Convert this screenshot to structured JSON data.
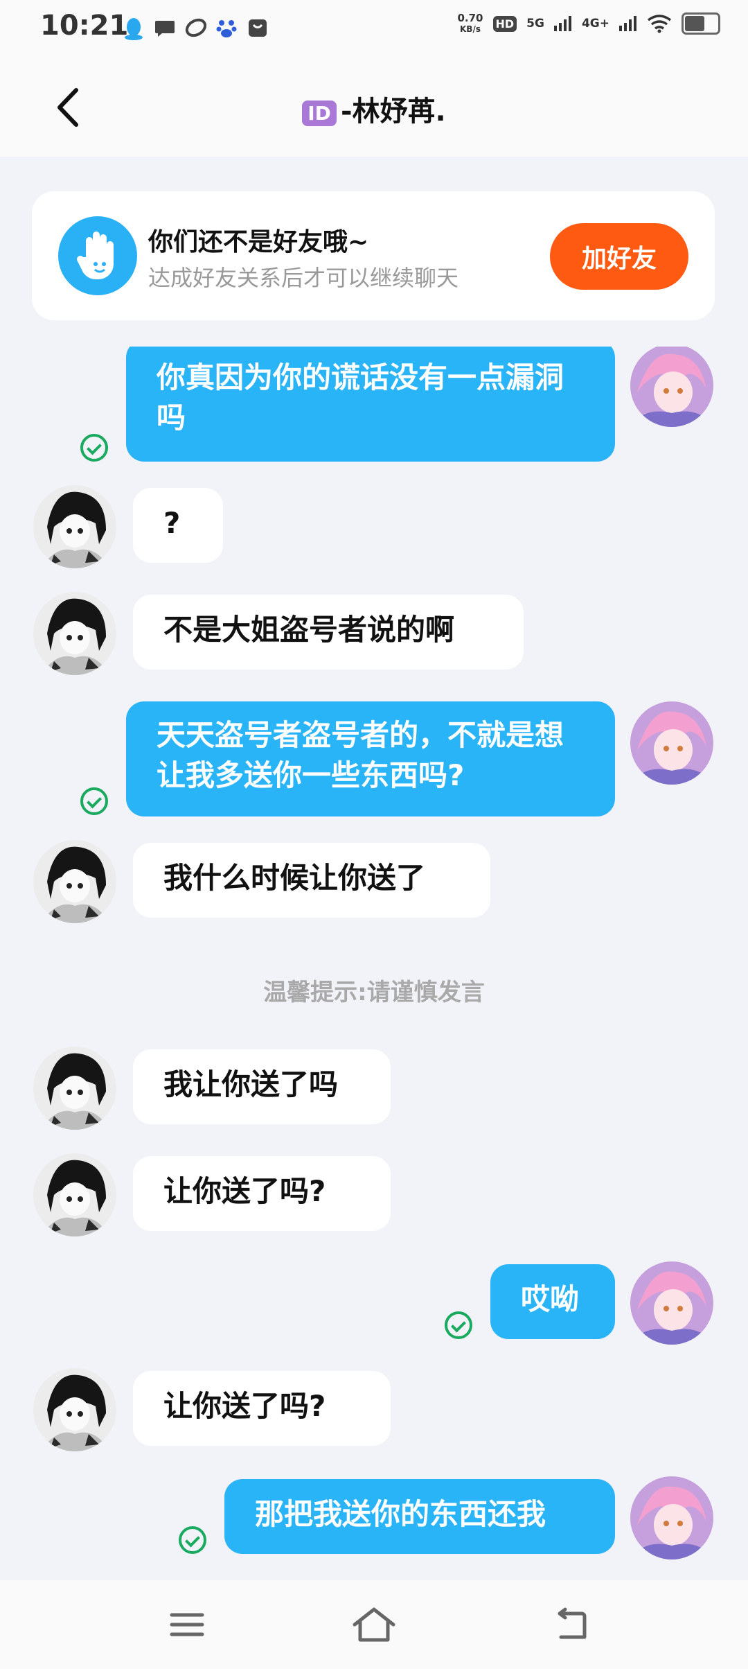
{
  "status_bar": {
    "time": "10:21",
    "net_speed_value": "0.70",
    "net_speed_unit": "KB/s",
    "hd_label": "HD",
    "signal_1": "5G",
    "signal_2": "4G+",
    "battery_level": 0.5
  },
  "header": {
    "id_badge": "ID",
    "title": "-林妤苒."
  },
  "banner": {
    "title": "你们还不是好友哦~",
    "subtitle": "达成好友关系后才可以继续聊天",
    "add_friend_label": "加好友"
  },
  "messages": [
    {
      "from": "me",
      "text": "你真因为你的谎话没有一点漏洞吗"
    },
    {
      "from": "other",
      "text": "?"
    },
    {
      "from": "other",
      "text": "不是大姐盗号者说的啊"
    },
    {
      "from": "me",
      "text": "天天盗号者盗号者的，不就是想让我多送你一些东西吗?"
    },
    {
      "from": "other",
      "text": "我什么时候让你送了"
    },
    {
      "from": "other",
      "text": "我让你送了吗"
    },
    {
      "from": "other",
      "text": "让你送了吗?"
    },
    {
      "from": "me",
      "text": "哎呦"
    },
    {
      "from": "other",
      "text": "让你送了吗?"
    },
    {
      "from": "me",
      "text": "那把我送你的东西还我"
    }
  ],
  "tip": "温馨提示:请谨慎发言",
  "colors": {
    "my_bubble": "#2ab4f8",
    "add_friend": "#ff5a12",
    "read_check": "#1aaa5f"
  }
}
